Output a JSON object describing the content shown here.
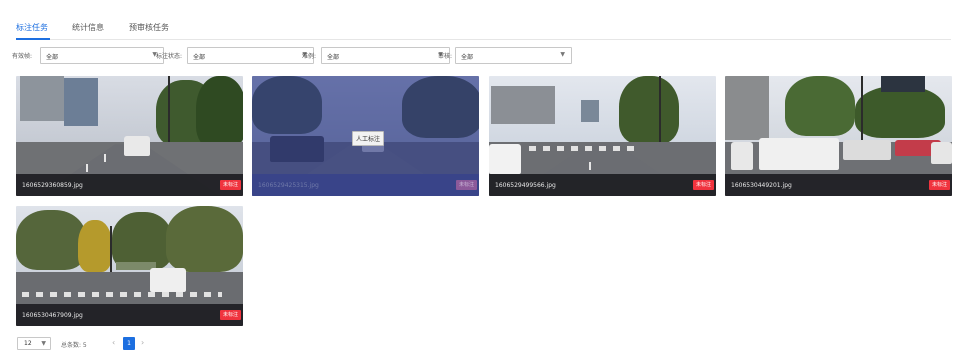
{
  "tabs": [
    {
      "label": "标注任务",
      "active": true
    },
    {
      "label": "统计信息",
      "active": false
    },
    {
      "label": "预审核任务",
      "active": false
    }
  ],
  "filters": [
    {
      "label": "有效帧:",
      "value": "全部"
    },
    {
      "label": "标注状态:",
      "value": "全部"
    },
    {
      "label": "难例:",
      "value": "全部"
    },
    {
      "label": "审核:",
      "value": "全部"
    }
  ],
  "images": [
    {
      "filename": "1606529360859.jpg",
      "status": "未标注"
    },
    {
      "filename": "1606529425315.jpg",
      "status": "未标注",
      "hover_action": "人工标注"
    },
    {
      "filename": "1606529499566.jpg",
      "status": "未标注"
    },
    {
      "filename": "1606530449201.jpg",
      "status": "未标注"
    },
    {
      "filename": "1606530467909.jpg",
      "status": "未标注"
    }
  ],
  "pagination": {
    "page_size": "12",
    "total_label": "总条数: 5",
    "current_page": "1"
  },
  "colors": {
    "accent": "#1d6fe0",
    "badge_unlabeled": "#f0333e",
    "hover_overlay": "#34408c"
  }
}
